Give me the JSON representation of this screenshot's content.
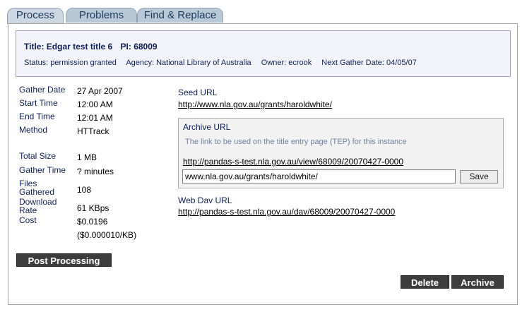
{
  "tabs": [
    {
      "label": "Process",
      "active": true
    },
    {
      "label": "Problems",
      "active": false
    },
    {
      "label": "Find & Replace",
      "active": false
    }
  ],
  "header": {
    "title_prefix": "Title:",
    "title": "Edgar test title 6",
    "pi_prefix": "PI:",
    "pi": "68009",
    "status": "Status: permission granted",
    "agency": "Agency: National Library of Australia",
    "owner": "Owner: ecrook",
    "next_gather": "Next Gather Date: 04/05/07"
  },
  "gather": {
    "gather_date_label": "Gather Date",
    "gather_date": "27 Apr 2007",
    "start_time_label": "Start Time",
    "start_time": "12:00 AM",
    "end_time_label": "End Time",
    "end_time": "12:01 AM",
    "method_label": "Method",
    "method": "HTTrack",
    "total_size_label": "Total Size",
    "total_size": "1 MB",
    "gather_time_label": "Gather Time",
    "gather_time": "? minutes",
    "files_label_1": "Files",
    "files_label_2": "Gathered",
    "files": "108",
    "rate_label_1": "Download",
    "rate_label_2": "Rate",
    "rate": "61 KBps",
    "cost_label": "Cost",
    "cost": "$0.0196",
    "cost_per_kb": "($0.000010/KB)"
  },
  "seed": {
    "label": "Seed URL",
    "url": "http://www.nla.gov.au/grants/haroldwhite/"
  },
  "archive": {
    "label": "Archive URL",
    "hint": "The link to be used on the title entry page (TEP) for this instance",
    "url": "http://pandas-s-test.nla.gov.au/view/68009/20070427-0000",
    "input_value": "www.nla.gov.au/grants/haroldwhite/",
    "save_label": "Save"
  },
  "webdav": {
    "label": "Web Dav URL",
    "url": "http://pandas-s-test.nla.gov.au/dav/68009/20070427-0000"
  },
  "buttons": {
    "post_processing": "Post Processing",
    "delete": "Delete",
    "archive": "Archive"
  }
}
